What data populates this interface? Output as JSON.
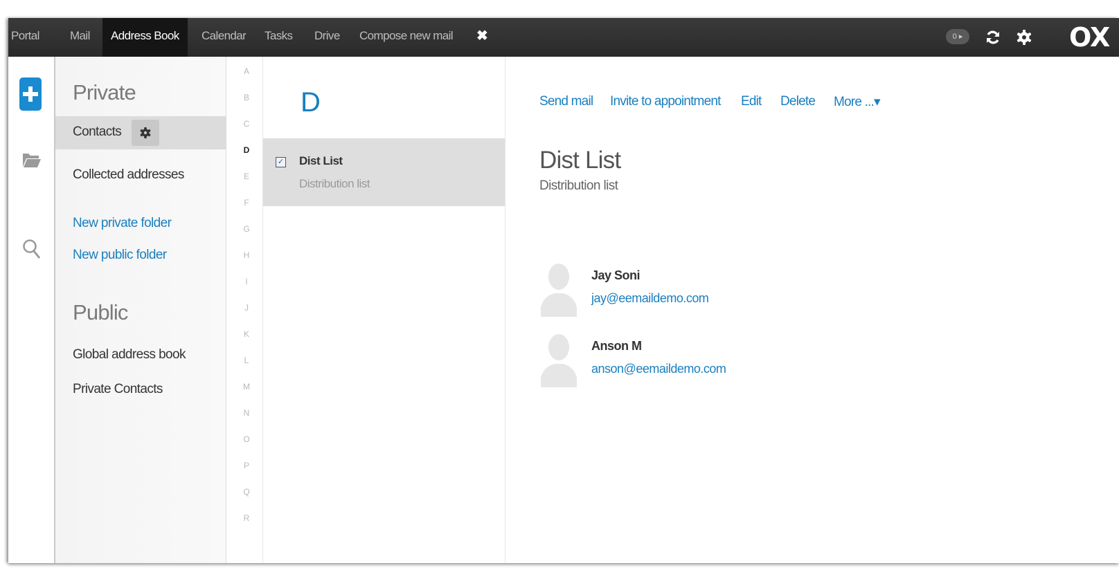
{
  "topbar": {
    "tabs": [
      "Portal",
      "Mail",
      "Address Book",
      "Calendar",
      "Tasks",
      "Drive",
      "Compose new mail"
    ],
    "active_tab": "Address Book",
    "close_glyph": "✖",
    "notification_badge": "0 ▸",
    "logo": "OX",
    "icons": [
      "refresh-icon",
      "settings-gear-icon"
    ]
  },
  "rail": {
    "icons": [
      "new-plus-icon",
      "folder-icon",
      "search-icon"
    ]
  },
  "sidebar": {
    "private_title": "Private",
    "private_items": [
      "Contacts",
      "Collected addresses"
    ],
    "selected_item": "Contacts",
    "links": [
      "New private folder",
      "New public folder"
    ],
    "public_title": "Public",
    "public_items": [
      "Global address book",
      "Private Contacts"
    ]
  },
  "letter_index": {
    "letters": [
      "A",
      "B",
      "C",
      "D",
      "E",
      "F",
      "G",
      "H",
      "I",
      "J",
      "K",
      "L",
      "M",
      "N",
      "O",
      "P",
      "Q",
      "R"
    ],
    "active_letter": "D"
  },
  "list": {
    "section_letter": "D",
    "items": [
      {
        "title": "Dist List",
        "subtitle": "Distribution list",
        "checked": true,
        "check_glyph": "✓"
      }
    ]
  },
  "detail": {
    "actions": [
      "Send mail",
      "Invite to appointment",
      "Edit",
      "Delete",
      "More ...▾"
    ],
    "title": "Dist List",
    "subtitle": "Distribution list",
    "members": [
      {
        "name": "Jay Soni",
        "email": "jay@eemaildemo.com"
      },
      {
        "name": "Anson M",
        "email": "anson@eemaildemo.com"
      }
    ]
  },
  "colors": {
    "accent": "#1a8ad1",
    "link": "#1a7fbf",
    "topbar": "#2f2f2f",
    "selection": "#dedede"
  }
}
